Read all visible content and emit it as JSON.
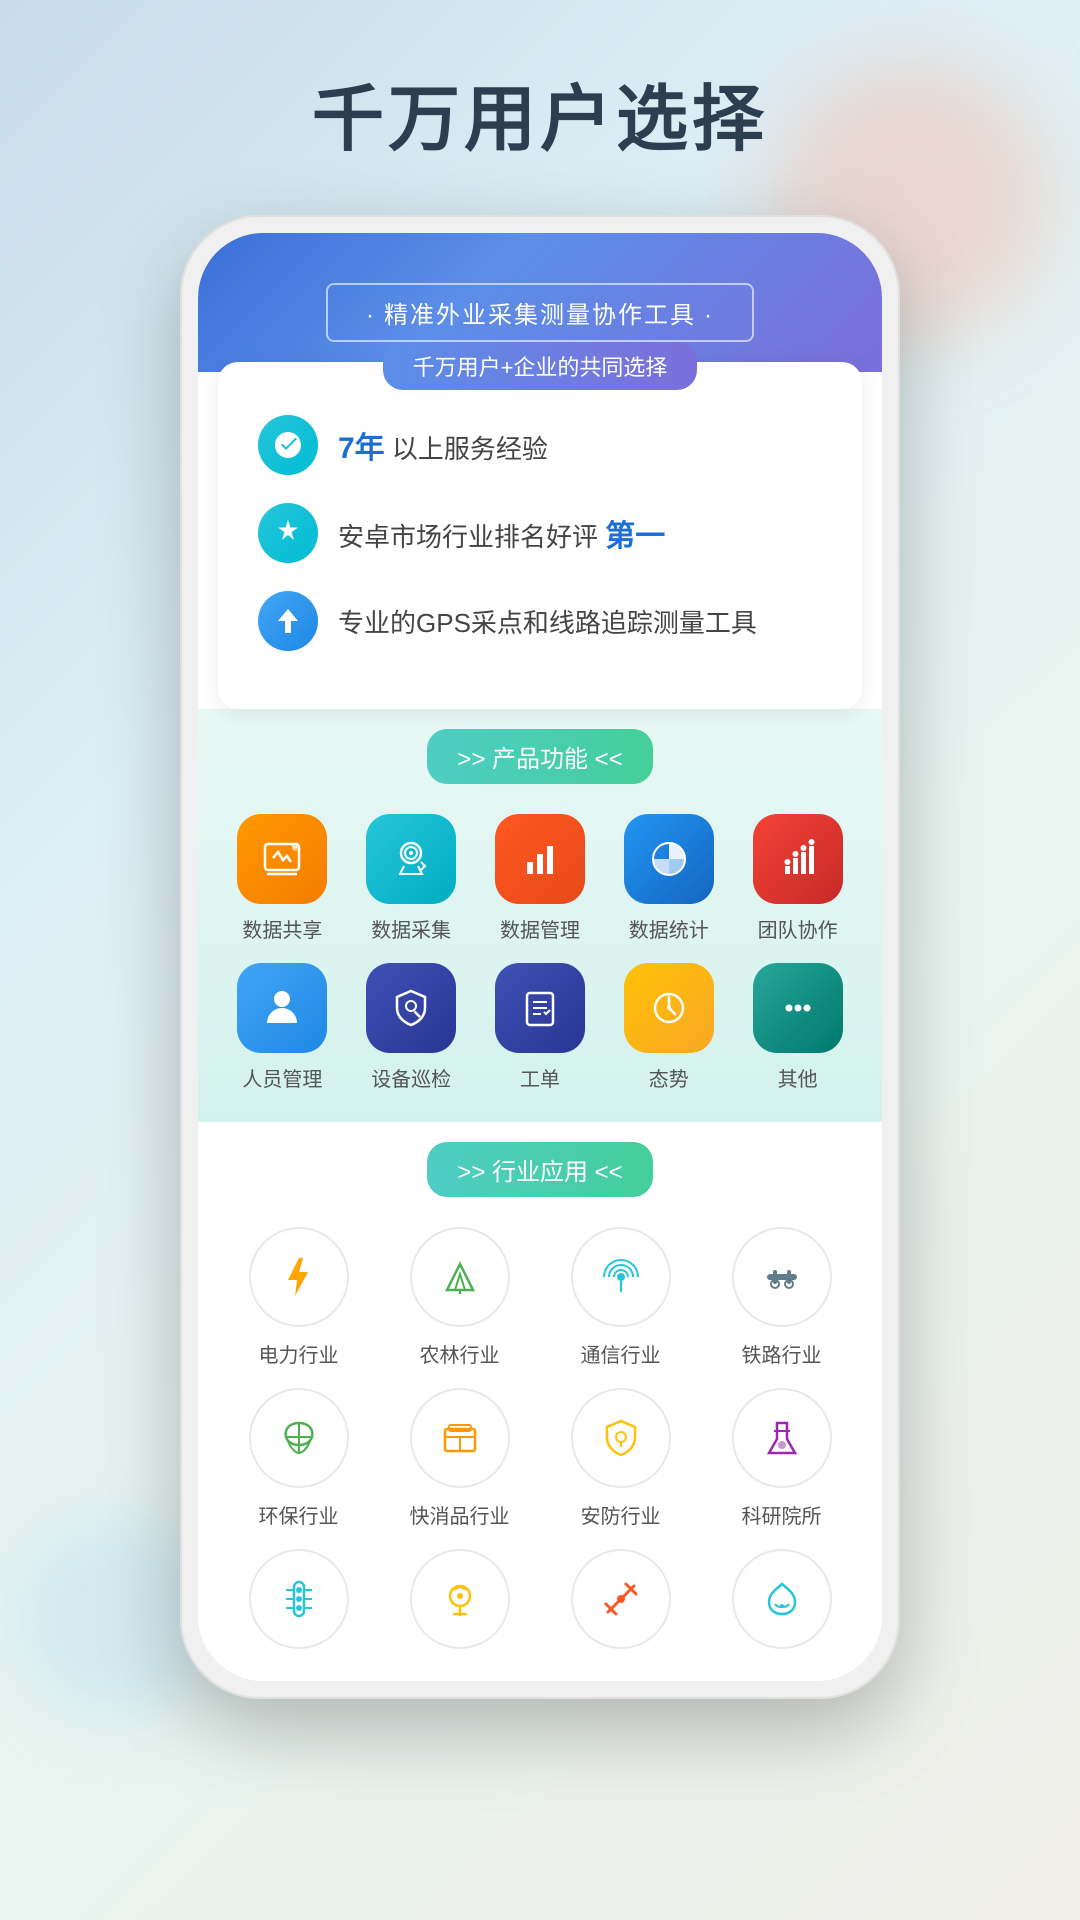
{
  "page": {
    "title": "千万用户选择",
    "bg_color": "#d4e8f0"
  },
  "banner": {
    "subtitle": "精准外业采集测量协作工具",
    "card_tag": "千万用户+企业的共同选择",
    "features": [
      {
        "icon": "❤",
        "icon_class": "icon-teal",
        "text_prefix": "",
        "highlight": "7年",
        "text_suffix": " 以上服务经验"
      },
      {
        "icon": "👑",
        "icon_class": "icon-teal",
        "text_prefix": "安卓市场行业排名好评 ",
        "highlight": "第一",
        "text_suffix": ""
      },
      {
        "icon": "➤",
        "icon_class": "icon-blue",
        "text_prefix": "专业的GPS采点和线路追踪测量工具",
        "highlight": "",
        "text_suffix": ""
      }
    ]
  },
  "product_section": {
    "tag": ">> 产品功能 <<",
    "items": [
      {
        "label": "数据共享",
        "icon": "📊",
        "color_class": "c-orange"
      },
      {
        "label": "数据采集",
        "icon": "🔍",
        "color_class": "c-teal"
      },
      {
        "label": "数据管理",
        "icon": "📈",
        "color_class": "c-red-orange"
      },
      {
        "label": "数据统计",
        "icon": "🥧",
        "color_class": "c-blue"
      },
      {
        "label": "团队协作",
        "icon": "📶",
        "color_class": "c-red"
      },
      {
        "label": "人员管理",
        "icon": "👤",
        "color_class": "c-blue2"
      },
      {
        "label": "设备巡检",
        "icon": "🛡",
        "color_class": "c-blue-dk"
      },
      {
        "label": "工单",
        "icon": "📋",
        "color_class": "c-blue-dk"
      },
      {
        "label": "态势",
        "icon": "⏰",
        "color_class": "c-amber"
      },
      {
        "label": "其他",
        "icon": "⋯",
        "color_class": "c-teal2"
      }
    ]
  },
  "industry_section": {
    "tag": ">> 行业应用 <<",
    "items": [
      {
        "label": "电力行业",
        "icon": "⚡",
        "color": "#ffa500"
      },
      {
        "label": "农林行业",
        "icon": "🏔",
        "color": "#4caf50"
      },
      {
        "label": "通信行业",
        "icon": "📡",
        "color": "#26c6da"
      },
      {
        "label": "铁路行业",
        "icon": "🔩",
        "color": "#607d8b"
      },
      {
        "label": "环保行业",
        "icon": "♻",
        "color": "#4caf50"
      },
      {
        "label": "快消品行业",
        "icon": "🗃",
        "color": "#ff9800"
      },
      {
        "label": "安防行业",
        "icon": "🛡",
        "color": "#ffc107"
      },
      {
        "label": "科研院所",
        "icon": "🔬",
        "color": "#9c27b0"
      },
      {
        "label": "",
        "icon": "🎛",
        "color": "#26c6da"
      },
      {
        "label": "",
        "icon": "💡",
        "color": "#ffc107"
      },
      {
        "label": "",
        "icon": "🔧",
        "color": "#ff5722"
      },
      {
        "label": "",
        "icon": "💧",
        "color": "#26c6da"
      }
    ]
  }
}
